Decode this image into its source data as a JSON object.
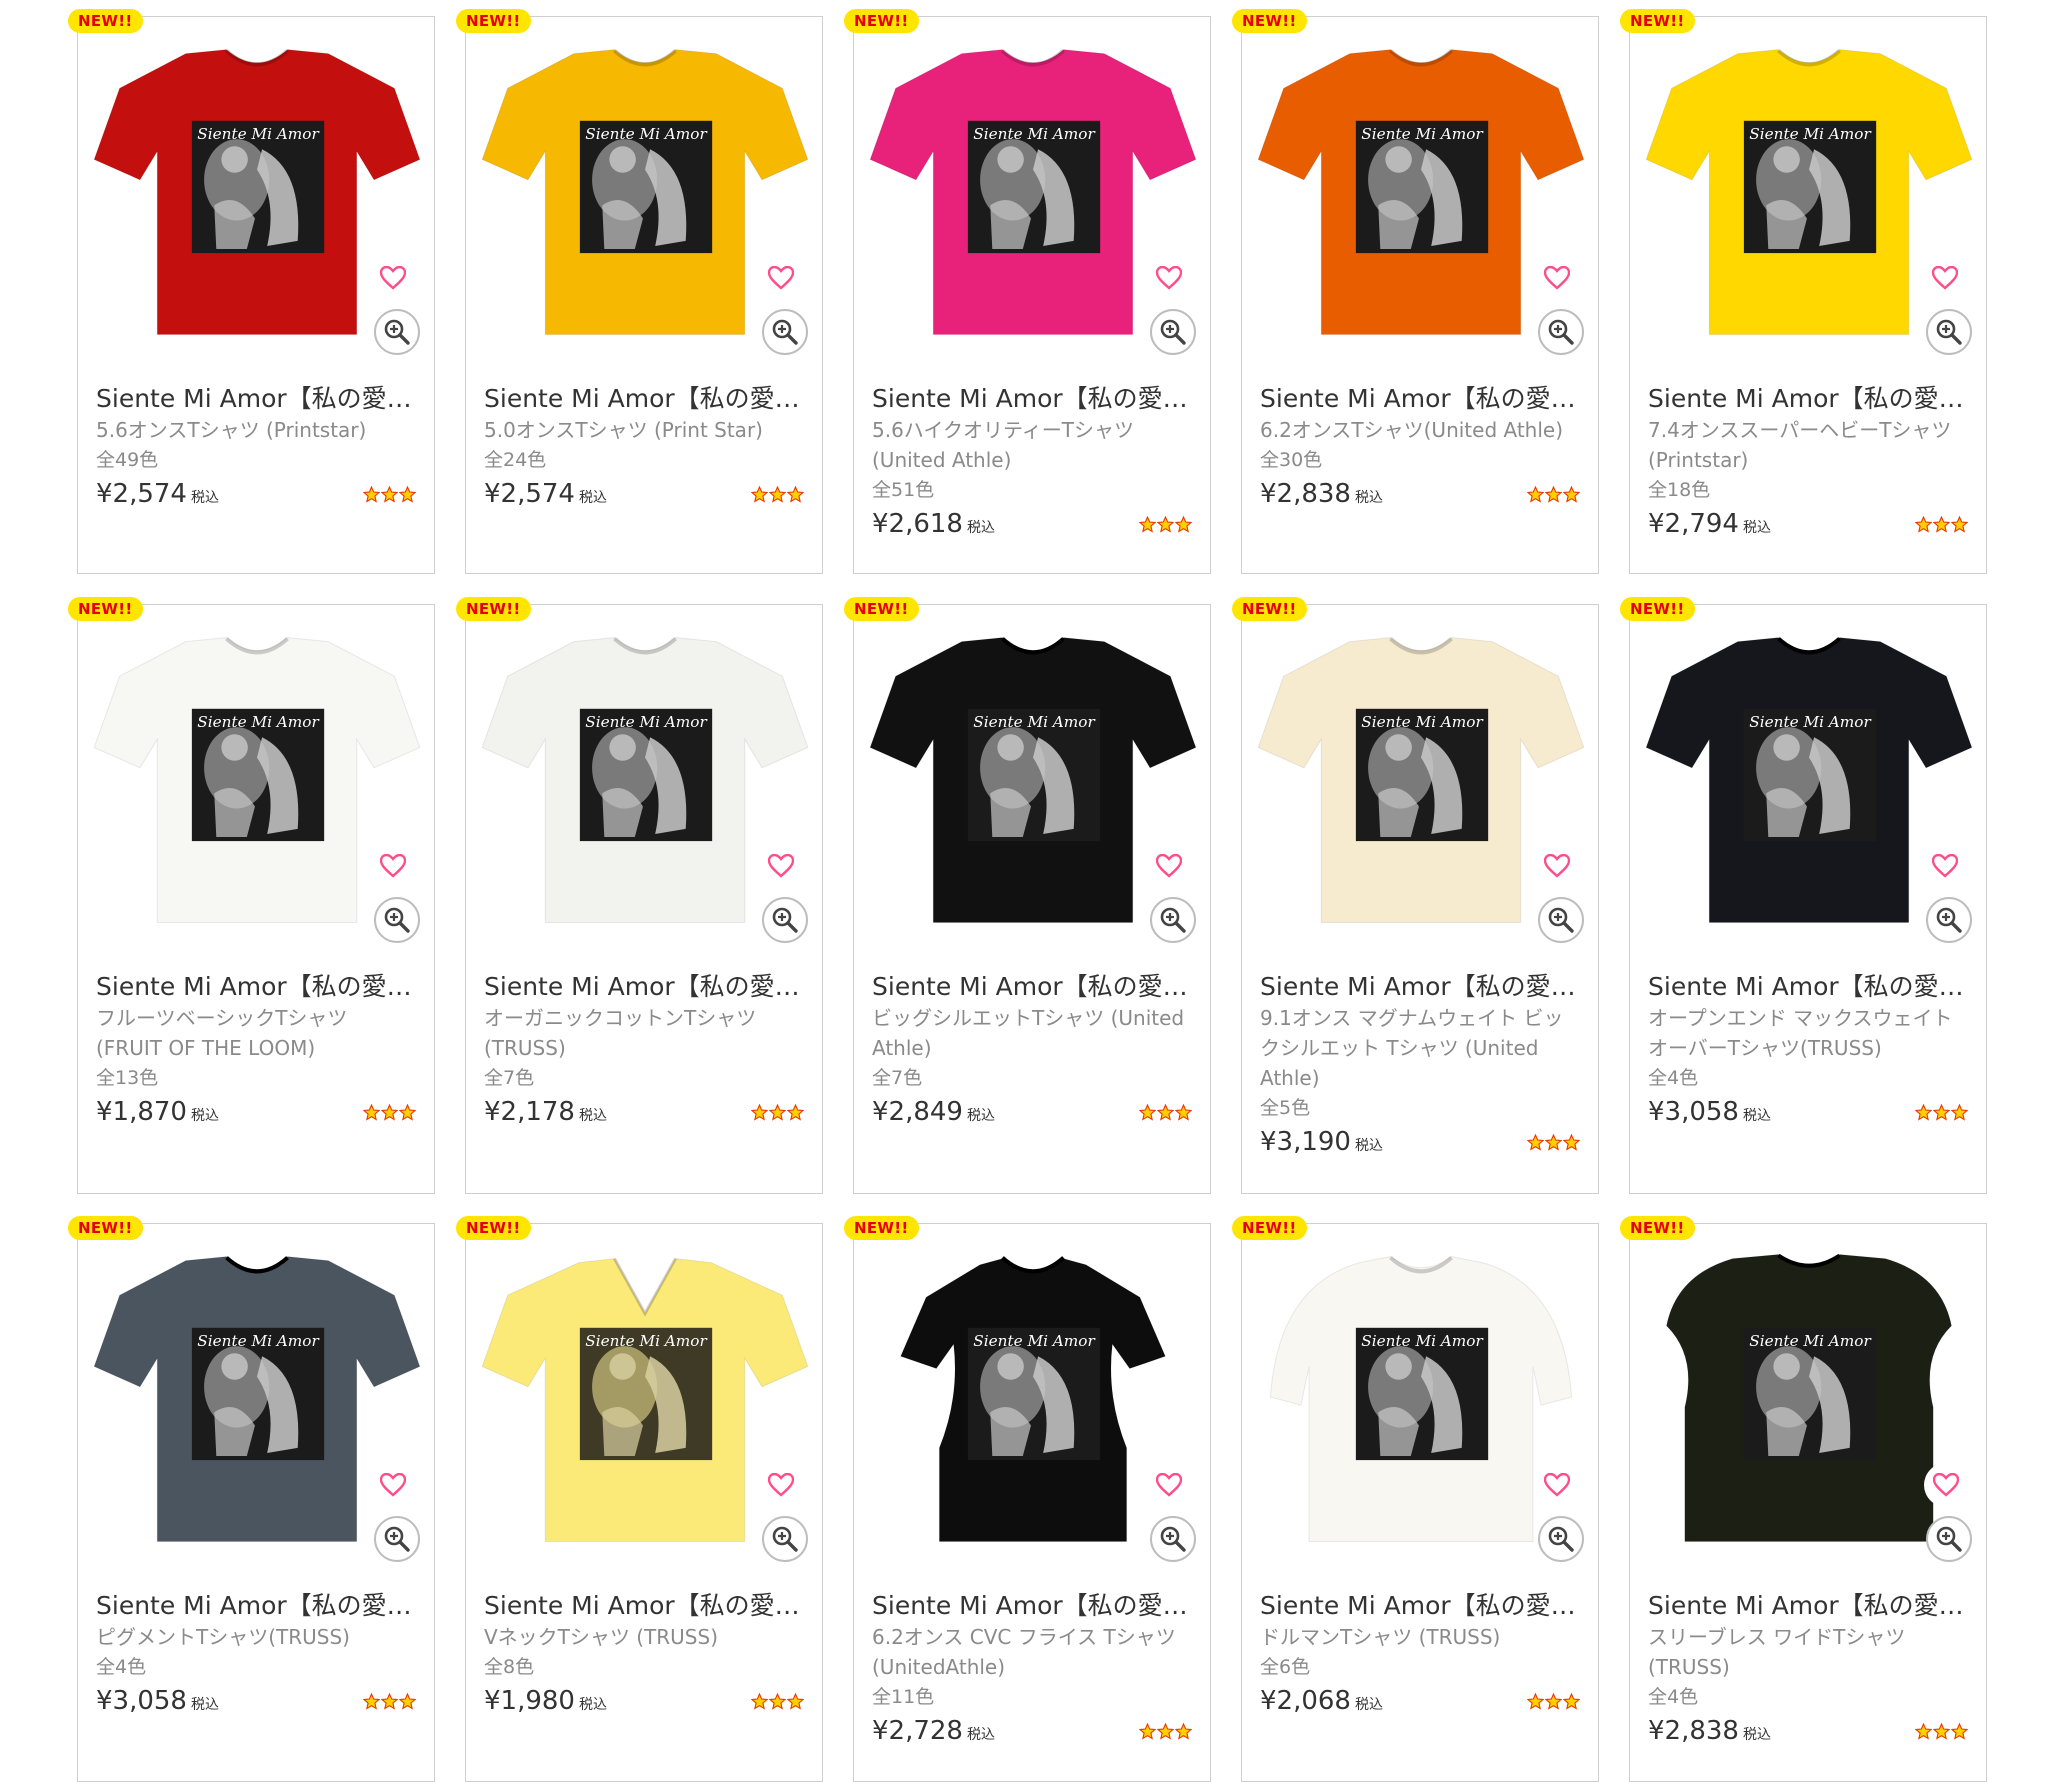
{
  "badge_label": "NEW!!",
  "tax_label": "税込",
  "products": [
    {
      "title": "Siente Mi Amor【私の愛…",
      "type": "5.6オンスTシャツ (Printstar)",
      "colors": "全49色",
      "price": "¥2,574",
      "shirt_color": "#c40f0f",
      "neck": "crew"
    },
    {
      "title": "Siente Mi Amor【私の愛…",
      "type": "5.0オンスTシャツ (Print Star)",
      "colors": "全24色",
      "price": "¥2,574",
      "shirt_color": "#f6b800",
      "neck": "crew"
    },
    {
      "title": "Siente Mi Amor【私の愛…",
      "type": "5.6ハイクオリティーTシャツ (United Athle)",
      "colors": "全51色",
      "price": "¥2,618",
      "shirt_color": "#e8217a",
      "neck": "crew"
    },
    {
      "title": "Siente Mi Amor【私の愛…",
      "type": "6.2オンスTシャツ(United Athle)",
      "colors": "全30色",
      "price": "¥2,838",
      "shirt_color": "#e85d00",
      "neck": "crew"
    },
    {
      "title": "Siente Mi Amor【私の愛…",
      "type": "7.4オンススーパーヘビーTシャツ (Printstar)",
      "colors": "全18色",
      "price": "¥2,794",
      "shirt_color": "#ffd800",
      "neck": "crew"
    },
    {
      "title": "Siente Mi Amor【私の愛…",
      "type": "フルーツベーシックTシャツ (FRUIT OF THE LOOM)",
      "colors": "全13色",
      "price": "¥1,870",
      "shirt_color": "#f7f7f4",
      "neck": "crew"
    },
    {
      "title": "Siente Mi Amor【私の愛…",
      "type": "オーガニックコットンTシャツ (TRUSS)",
      "colors": "全7色",
      "price": "¥2,178",
      "shirt_color": "#f2f2ee",
      "neck": "crew"
    },
    {
      "title": "Siente Mi Amor【私の愛…",
      "type": "ビッグシルエットTシャツ (United Athle)",
      "colors": "全7色",
      "price": "¥2,849",
      "shirt_color": "#111111",
      "neck": "crew"
    },
    {
      "title": "Siente Mi Amor【私の愛…",
      "type": "9.1オンス マグナムウェイト ビックシルエット Tシャツ (United Athle)",
      "colors": "全5色",
      "price": "¥3,190",
      "shirt_color": "#f6ebcf",
      "neck": "crew"
    },
    {
      "title": "Siente Mi Amor【私の愛…",
      "type": "オープンエンド マックスウェイト オーバーTシャツ(TRUSS)",
      "colors": "全4色",
      "price": "¥3,058",
      "shirt_color": "#15171c",
      "neck": "crew"
    },
    {
      "title": "Siente Mi Amor【私の愛…",
      "type": "ピグメントTシャツ(TRUSS)",
      "colors": "全4色",
      "price": "¥3,058",
      "shirt_color": "#4a5560",
      "neck": "crew"
    },
    {
      "title": "Siente Mi Amor【私の愛…",
      "type": "VネックTシャツ (TRUSS)",
      "colors": "全8色",
      "price": "¥1,980",
      "shirt_color": "#fbea78",
      "neck": "v"
    },
    {
      "title": "Siente Mi Amor【私の愛…",
      "type": "6.2オンス CVC フライス Tシャツ (UnitedAthle)",
      "colors": "全11色",
      "price": "¥2,728",
      "shirt_color": "#0d0d0d",
      "neck": "fitted"
    },
    {
      "title": "Siente Mi Amor【私の愛…",
      "type": "ドルマンTシャツ (TRUSS)",
      "colors": "全6色",
      "price": "¥2,068",
      "shirt_color": "#f8f7f2",
      "neck": "dolman"
    },
    {
      "title": "Siente Mi Amor【私の愛…",
      "type": "スリーブレス ワイドTシャツ (TRUSS)",
      "colors": "全4色",
      "price": "¥2,838",
      "shirt_color": "#1c1f14",
      "neck": "sleeveless"
    }
  ],
  "print_text": "Siente Mi Amor"
}
